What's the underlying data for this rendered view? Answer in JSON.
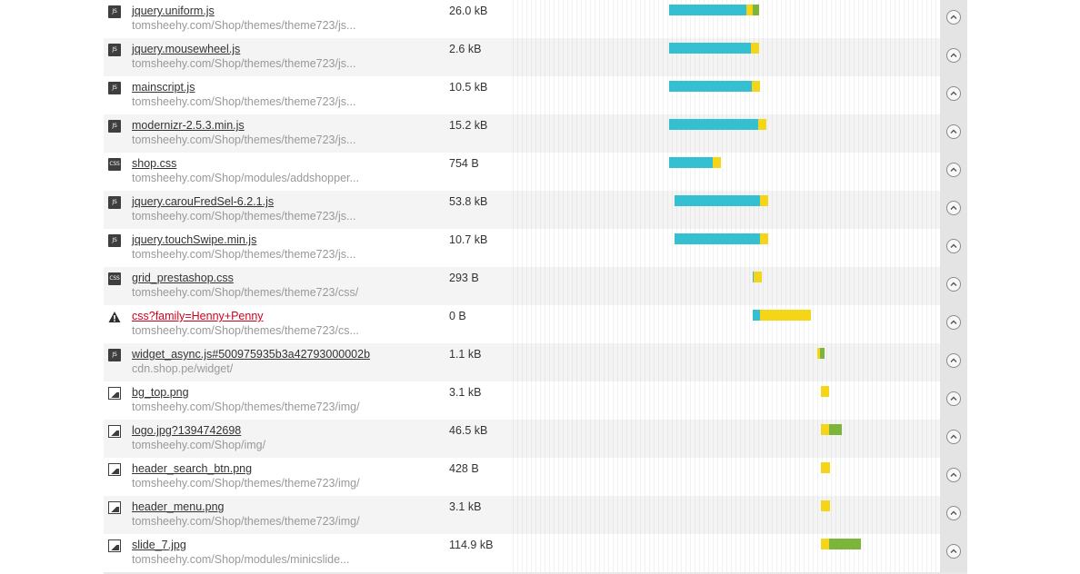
{
  "legend_colors": {
    "waiting": "#34c0d0",
    "receiving": "#f5d517",
    "downloading": "#7db53a",
    "error_text": "#d0021b"
  },
  "resources": [
    {
      "icon": "js-file-icon",
      "badge": "JS",
      "name": "jquery.uniform.js",
      "url": "tomsheehy.com/Shop/themes/theme723/js...",
      "size": "26.0 kB",
      "error": false
    },
    {
      "icon": "js-file-icon",
      "badge": "JS",
      "name": "jquery.mousewheel.js",
      "url": "tomsheehy.com/Shop/themes/theme723/js...",
      "size": "2.6 kB",
      "error": false
    },
    {
      "icon": "js-file-icon",
      "badge": "JS",
      "name": "mainscript.js",
      "url": "tomsheehy.com/Shop/themes/theme723/js...",
      "size": "10.5 kB",
      "error": false
    },
    {
      "icon": "js-file-icon",
      "badge": "JS",
      "name": "modernizr-2.5.3.min.js",
      "url": "tomsheehy.com/Shop/themes/theme723/js...",
      "size": "15.2 kB",
      "error": false
    },
    {
      "icon": "css-file-icon",
      "badge": "CSS",
      "name": "shop.css",
      "url": "tomsheehy.com/Shop/modules/addshopper...",
      "size": "754 B",
      "error": false
    },
    {
      "icon": "js-file-icon",
      "badge": "JS",
      "name": "jquery.carouFredSel-6.2.1.js",
      "url": "tomsheehy.com/Shop/themes/theme723/js...",
      "size": "53.8 kB",
      "error": false
    },
    {
      "icon": "js-file-icon",
      "badge": "JS",
      "name": "jquery.touchSwipe.min.js",
      "url": "tomsheehy.com/Shop/themes/theme723/js...",
      "size": "10.7 kB",
      "error": false
    },
    {
      "icon": "css-file-icon",
      "badge": "CSS",
      "name": "grid_prestashop.css",
      "url": "tomsheehy.com/Shop/themes/theme723/css/",
      "size": "293 B",
      "error": false
    },
    {
      "icon": "warning-icon",
      "badge": "",
      "name": "css?family=Henny+Penny",
      "url": "tomsheehy.com/Shop/themes/theme723/cs...",
      "size": "0 B",
      "error": true
    },
    {
      "icon": "js-file-icon",
      "badge": "JS",
      "name": "widget_async.js#500975935b3a42793000002b",
      "url": "cdn.shop.pe/widget/",
      "size": "1.1 kB",
      "error": false
    },
    {
      "icon": "image-file-icon",
      "badge": "",
      "name": "bg_top.png",
      "url": "tomsheehy.com/Shop/themes/theme723/img/",
      "size": "3.1 kB",
      "error": false
    },
    {
      "icon": "image-file-icon",
      "badge": "",
      "name": "logo.jpg?1394742698",
      "url": "tomsheehy.com/Shop/img/",
      "size": "46.5 kB",
      "error": false
    },
    {
      "icon": "image-file-icon",
      "badge": "",
      "name": "header_search_btn.png",
      "url": "tomsheehy.com/Shop/themes/theme723/img/",
      "size": "428 B",
      "error": false
    },
    {
      "icon": "image-file-icon",
      "badge": "",
      "name": "header_menu.png",
      "url": "tomsheehy.com/Shop/themes/theme723/img/",
      "size": "3.1 kB",
      "error": false
    },
    {
      "icon": "image-file-icon",
      "badge": "",
      "name": "slide_7.jpg",
      "url": "tomsheehy.com/Shop/modules/minicslide...",
      "size": "114.9 kB",
      "error": false
    }
  ]
}
